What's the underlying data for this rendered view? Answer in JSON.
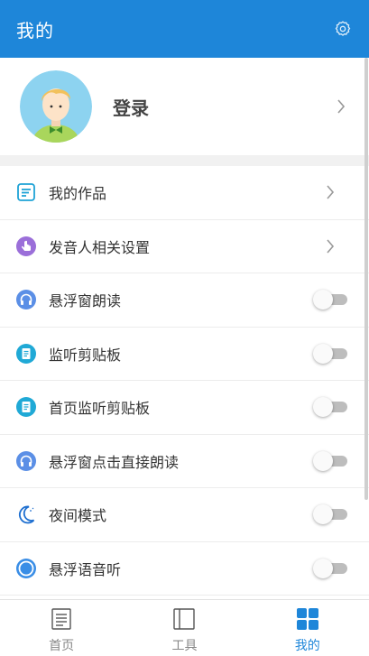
{
  "appbar": {
    "title": "我的",
    "settings_icon": "gear-icon"
  },
  "profile": {
    "login_label": "登录",
    "avatar_icon": "avatar-boy-icon"
  },
  "menu": [
    {
      "label": "我的作品",
      "icon": "works-icon",
      "icon_color": "#1fa3d6",
      "control": "chevron"
    },
    {
      "label": "发音人相关设置",
      "icon": "hand-pointer-icon",
      "icon_color": "#9b6fd9",
      "control": "chevron"
    },
    {
      "label": "悬浮窗朗读",
      "icon": "headphones-icon",
      "icon_color": "#5b8fe6",
      "control": "switch",
      "on": false
    },
    {
      "label": "监听剪贴板",
      "icon": "clipboard-icon",
      "icon_color": "#20a9d6",
      "control": "switch",
      "on": false
    },
    {
      "label": "首页监听剪贴板",
      "icon": "clipboard-icon",
      "icon_color": "#20a9d6",
      "control": "switch",
      "on": false
    },
    {
      "label": "悬浮窗点击直接朗读",
      "icon": "headphones-icon",
      "icon_color": "#5b8fe6",
      "control": "switch",
      "on": false
    },
    {
      "label": "夜间模式",
      "icon": "moon-icon",
      "icon_color": "#1e6fd0",
      "control": "switch",
      "on": false
    },
    {
      "label": "悬浮语音听",
      "icon": "circle-icon",
      "icon_color": "#3a8ee6",
      "control": "switch",
      "on": false
    }
  ],
  "tabbar": {
    "tabs": [
      {
        "label": "首页",
        "icon": "document-icon",
        "active": false
      },
      {
        "label": "工具",
        "icon": "book-icon",
        "active": false
      },
      {
        "label": "我的",
        "icon": "grid-icon",
        "active": true
      }
    ]
  },
  "colors": {
    "primary": "#1e86d9",
    "switch_off": "#bdbdbd"
  }
}
